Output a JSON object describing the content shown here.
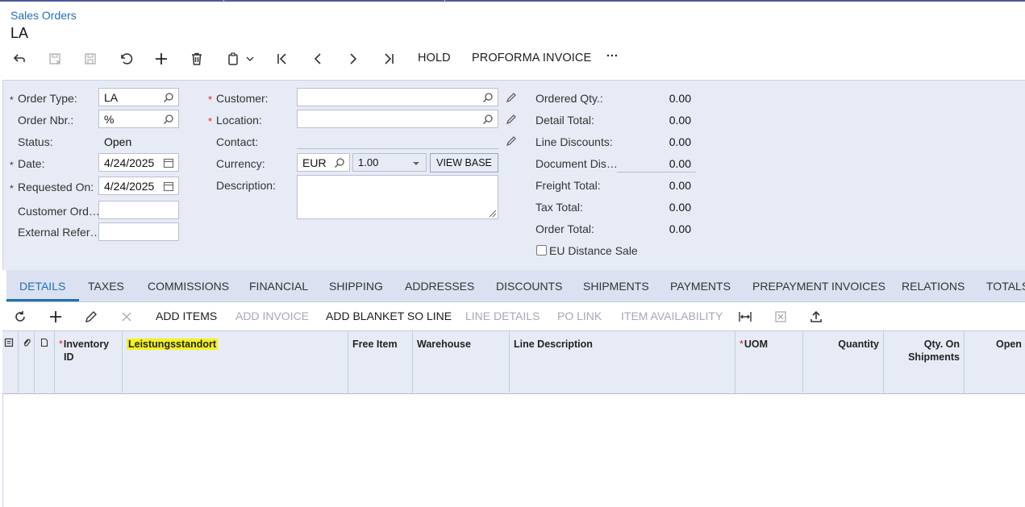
{
  "header": {
    "breadcrumb": "Sales Orders",
    "title": "LA"
  },
  "toolbar": {
    "back_icon": "back-arrow-icon",
    "save_close_icon": "save-close-icon",
    "save_icon": "save-icon",
    "undo_icon": "undo-icon",
    "add_icon": "plus-icon",
    "delete_icon": "trash-icon",
    "copy_icon": "clipboard-icon",
    "first_icon": "first-record-icon",
    "prev_icon": "previous-icon",
    "next_icon": "next-icon",
    "last_icon": "last-record-icon",
    "hold_label": "HOLD",
    "proforma_label": "PROFORMA INVOICE",
    "more_label": "···"
  },
  "form": {
    "order_type": {
      "label": "Order Type:",
      "value": "LA"
    },
    "order_nbr": {
      "label": "Order Nbr.:",
      "value": "%"
    },
    "status": {
      "label": "Status:",
      "value": "Open"
    },
    "date": {
      "label": "Date:",
      "value": "4/24/2025"
    },
    "requested_on": {
      "label": "Requested On:",
      "value": "4/24/2025"
    },
    "customer_order": {
      "label": "Customer Ord…",
      "value": ""
    },
    "external_ref": {
      "label": "External Refer…",
      "value": ""
    },
    "customer": {
      "label": "Customer:",
      "value": ""
    },
    "location": {
      "label": "Location:",
      "value": ""
    },
    "contact": {
      "label": "Contact:",
      "value": ""
    },
    "currency": {
      "label": "Currency:",
      "code": "EUR",
      "rate": "1.00",
      "view_base": "VIEW BASE"
    },
    "description": {
      "label": "Description:",
      "value": ""
    },
    "required_marker": "*"
  },
  "totals": [
    {
      "label": "Ordered Qty.:",
      "value": "0.00"
    },
    {
      "label": "Detail Total:",
      "value": "0.00"
    },
    {
      "label": "Line Discounts:",
      "value": "0.00"
    },
    {
      "label": "Document Dis…",
      "value": "0.00"
    },
    {
      "label": "Freight Total:",
      "value": "0.00"
    },
    {
      "label": "Tax Total:",
      "value": "0.00"
    },
    {
      "label": "Order Total:",
      "value": "0.00"
    }
  ],
  "eu_distance_sale": {
    "label": "EU Distance Sale",
    "checked": false
  },
  "tabs": [
    "DETAILS",
    "TAXES",
    "COMMISSIONS",
    "FINANCIAL",
    "SHIPPING",
    "ADDRESSES",
    "DISCOUNTS",
    "SHIPMENTS",
    "PAYMENTS",
    "PREPAYMENT INVOICES",
    "RELATIONS",
    "TOTALS"
  ],
  "grid_toolbar": {
    "add_items": "ADD ITEMS",
    "add_invoice": "ADD INVOICE",
    "add_blanket": "ADD BLANKET SO LINE",
    "line_details": "LINE DETAILS",
    "po_link": "PO LINK",
    "item_availability": "ITEM AVAILABILITY"
  },
  "grid_columns": {
    "inventory_id_1": "Inventory",
    "inventory_id_2": "ID",
    "leistungsstandort": "Leistungsstandort",
    "free_item": "Free Item",
    "warehouse": "Warehouse",
    "line_description": "Line Description",
    "uom": "UOM",
    "quantity": "Quantity",
    "qty_on_ship_1": "Qty. On",
    "qty_on_ship_2": "Shipments",
    "open_qty": "Open Q"
  },
  "colors": {
    "accent": "#1f6fb5",
    "panel": "#e7ebf6",
    "highlight": "#f4f21a",
    "required": "#dd2222"
  }
}
